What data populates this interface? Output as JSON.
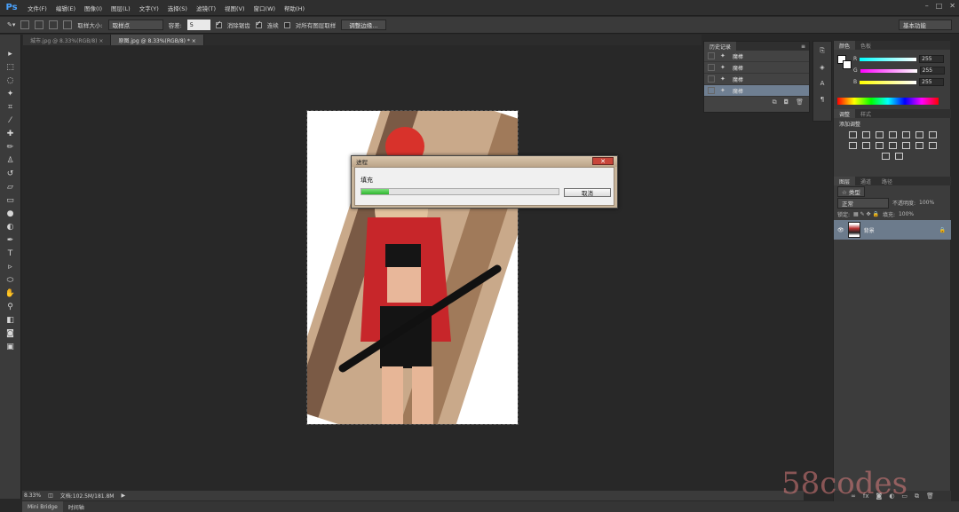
{
  "app": {
    "logo": "Ps"
  },
  "menu": [
    "文件(F)",
    "编辑(E)",
    "图像(I)",
    "图层(L)",
    "文字(Y)",
    "选择(S)",
    "滤镜(T)",
    "视图(V)",
    "窗口(W)",
    "帮助(H)"
  ],
  "options": {
    "sample_size_label": "取样大小:",
    "sample_size_value": "取样点",
    "tolerance_label": "容差:",
    "tolerance_value": "5",
    "antialias_label": "消除锯齿",
    "contiguous_label": "连续",
    "all_layers_label": "对所有图层取样",
    "refine_edge_label": "调整边缘...",
    "workspace": "基本功能"
  },
  "tabs": [
    {
      "label": "城市.jpg @ 8.33%(RGB/8) ×"
    },
    {
      "label": "原图.jpg @ 8.33%(RGB/8) * ×"
    }
  ],
  "history": {
    "tabs": [
      "历史记录"
    ],
    "rows": [
      "魔棒",
      "魔棒",
      "魔棒",
      "魔棒"
    ]
  },
  "color_panel": {
    "tabs": [
      "颜色",
      "色板"
    ],
    "channels": [
      {
        "label": "R",
        "value": "255"
      },
      {
        "label": "G",
        "value": "255"
      },
      {
        "label": "B",
        "value": "255"
      }
    ]
  },
  "adjustments": {
    "tabs": [
      "调整",
      "样式"
    ],
    "title": "添加调整"
  },
  "layers": {
    "tabs": [
      "图层",
      "通道",
      "路径"
    ],
    "kind_label": "☆ 类型",
    "blend_mode": "正常",
    "opacity_label": "不透明度:",
    "opacity_value": "100%",
    "lock_label": "锁定:",
    "fill_label": "填充:",
    "fill_value": "100%",
    "layer_name": "背景"
  },
  "status": {
    "zoom": "8.33%",
    "doc": "文档:102.5M/181.8M"
  },
  "bottom_tabs": [
    "Mini Bridge",
    "时间轴"
  ],
  "dialog": {
    "title": "进程",
    "message": "填充",
    "progress": 0.14,
    "cancel": "取消"
  },
  "watermark": "58codes"
}
